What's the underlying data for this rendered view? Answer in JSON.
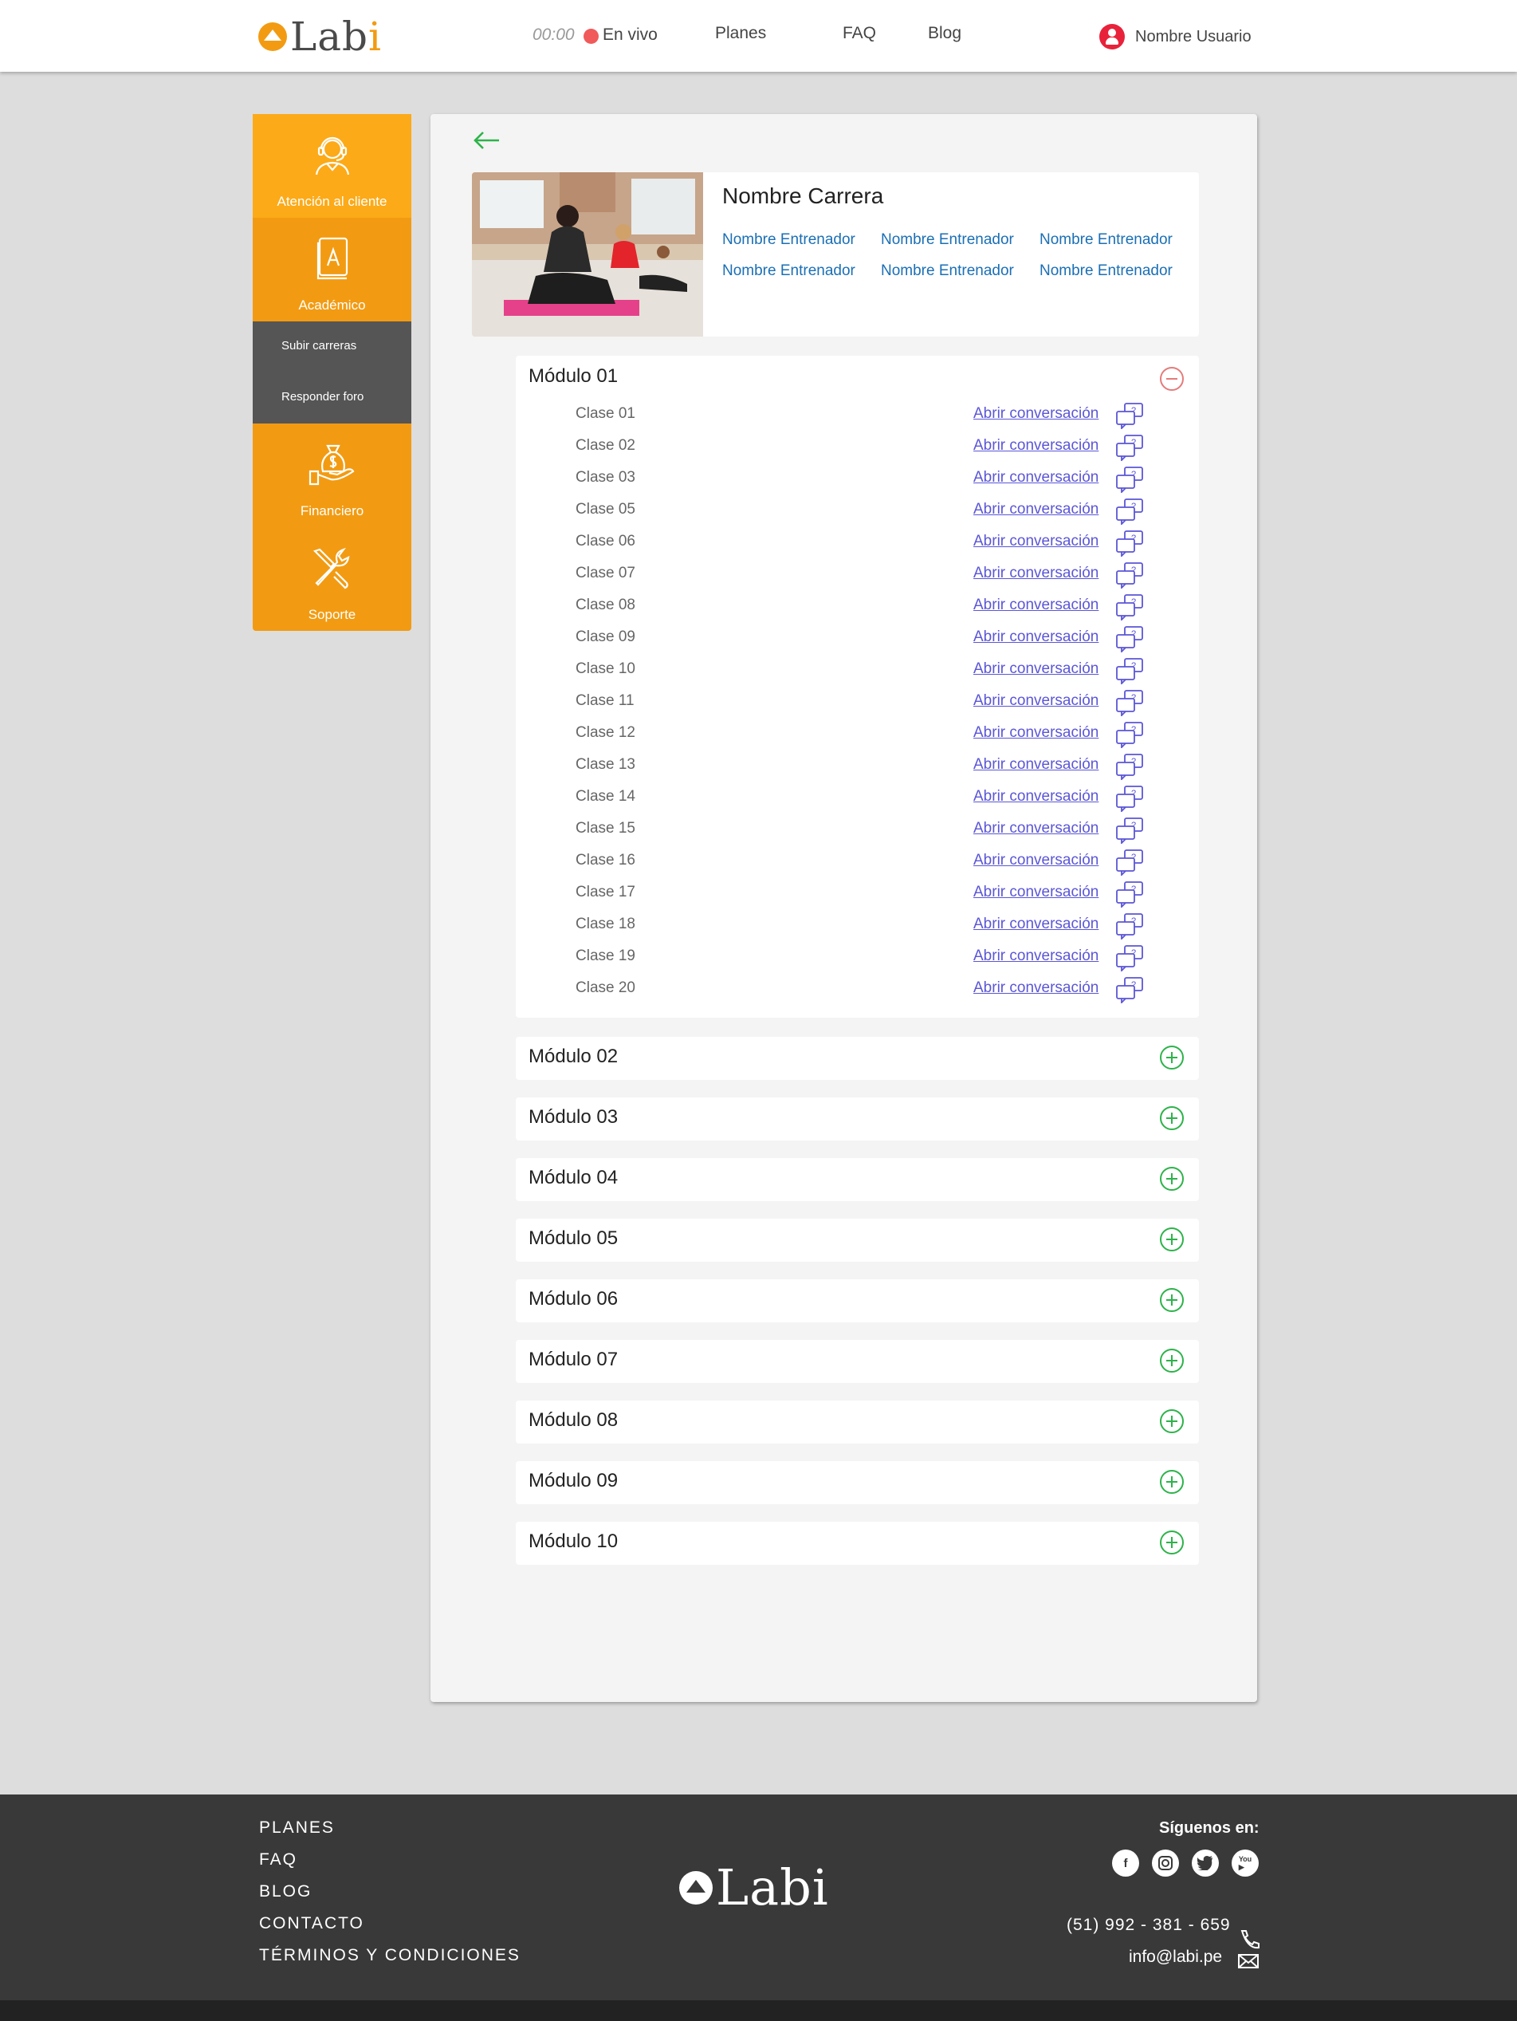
{
  "header": {
    "logo_text": "Labi",
    "live_time": "00:00",
    "live_label": "En vivo",
    "nav": [
      "Planes",
      "FAQ",
      "Blog"
    ],
    "user_name": "Nombre Usuario"
  },
  "sidebar": {
    "items": [
      {
        "label": "Atención al cliente",
        "icon": "customer-support-icon"
      },
      {
        "label": "Académico",
        "icon": "book-icon"
      },
      {
        "label": "Financiero",
        "icon": "money-bag-icon"
      },
      {
        "label": "Soporte",
        "icon": "tools-icon"
      }
    ],
    "submenu": [
      "Subir carreras",
      "Responder foro"
    ]
  },
  "career": {
    "title": "Nombre Carrera",
    "trainers": [
      "Nombre Entrenador",
      "Nombre Entrenador",
      "Nombre Entrenador",
      "Nombre Entrenador",
      "Nombre Entrenador",
      "Nombre Entrenador"
    ]
  },
  "modules": {
    "open": {
      "title": "Módulo 01",
      "link_label": "Abrir conversación",
      "classes": [
        "Clase 01",
        "Clase 02",
        "Clase 03",
        "Clase 05",
        "Clase 06",
        "Clase 07",
        "Clase 08",
        "Clase 09",
        "Clase 10",
        "Clase 11",
        "Clase 12",
        "Clase 13",
        "Clase 14",
        "Clase 15",
        "Clase 16",
        "Clase 17",
        "Clase 18",
        "Clase 19",
        "Clase 20"
      ]
    },
    "closed": [
      "Módulo 02",
      "Módulo 03",
      "Módulo 04",
      "Módulo 05",
      "Módulo 06",
      "Módulo 07",
      "Módulo 08",
      "Módulo 09",
      "Módulo 10"
    ]
  },
  "footer": {
    "links": [
      "PLANES",
      "FAQ",
      "BLOG",
      "CONTACTO",
      "TÉRMINOS Y CONDICIONES"
    ],
    "logo_text": "Labi",
    "follow_label": "Síguenos en:",
    "social": [
      "facebook-icon",
      "instagram-icon",
      "twitter-icon",
      "youtube-icon"
    ],
    "phone": "(51) 992 - 381 - 659",
    "email": "info@labi.pe"
  },
  "colors": {
    "accent_orange": "#f29b12",
    "accent_orange_light": "#fcaa18",
    "link_blue": "#1a6fb5",
    "link_purple": "#5b56d6",
    "green": "#2db34a",
    "live_red": "#f05a5a",
    "footer_bg": "#393939"
  }
}
